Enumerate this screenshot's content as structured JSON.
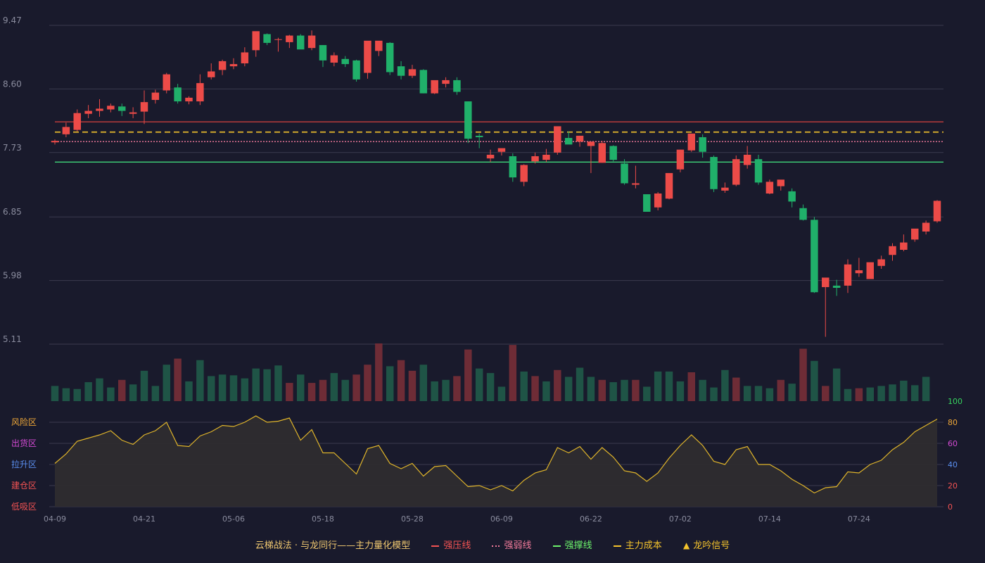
{
  "chart_data": [
    {
      "type": "candlestick",
      "y_ticks": [
        "9.47",
        "8.60",
        "7.73",
        "6.85",
        "5.98",
        "5.11"
      ],
      "ylim": [
        5.11,
        9.47
      ],
      "x_tick_labels": [
        "04-09",
        "04-21",
        "05-06",
        "05-18",
        "05-28",
        "06-09",
        "06-22",
        "07-02",
        "07-14",
        "07-24"
      ],
      "x_tick_index": [
        0,
        8,
        16,
        24,
        32,
        40,
        48,
        56,
        64,
        72
      ],
      "ohlc": [
        [
          7.87,
          7.91,
          7.84,
          7.89
        ],
        [
          7.98,
          8.14,
          7.94,
          8.08
        ],
        [
          8.04,
          8.32,
          8.02,
          8.27
        ],
        [
          8.26,
          8.38,
          8.2,
          8.3
        ],
        [
          8.3,
          8.46,
          8.22,
          8.33
        ],
        [
          8.32,
          8.4,
          8.28,
          8.37
        ],
        [
          8.36,
          8.4,
          8.23,
          8.3
        ],
        [
          8.26,
          8.35,
          8.2,
          8.28
        ],
        [
          8.29,
          8.58,
          8.12,
          8.42
        ],
        [
          8.45,
          8.59,
          8.4,
          8.55
        ],
        [
          8.58,
          8.82,
          8.54,
          8.8
        ],
        [
          8.62,
          8.67,
          8.4,
          8.43
        ],
        [
          8.43,
          8.5,
          8.39,
          8.48
        ],
        [
          8.43,
          8.8,
          8.38,
          8.68
        ],
        [
          8.76,
          8.95,
          8.73,
          8.84
        ],
        [
          8.86,
          9.0,
          8.79,
          8.98
        ],
        [
          8.91,
          9.02,
          8.87,
          8.94
        ],
        [
          8.95,
          9.17,
          8.91,
          9.1
        ],
        [
          9.13,
          9.3,
          9.04,
          9.39
        ],
        [
          9.35,
          9.36,
          9.2,
          9.23
        ],
        [
          9.28,
          9.3,
          9.11,
          9.28
        ],
        [
          9.24,
          9.34,
          9.16,
          9.33
        ],
        [
          9.33,
          9.35,
          9.15,
          9.14
        ],
        [
          9.16,
          9.4,
          9.13,
          9.33
        ],
        [
          9.2,
          9.2,
          8.9,
          8.99
        ],
        [
          8.96,
          9.1,
          8.91,
          9.06
        ],
        [
          9.01,
          9.05,
          8.9,
          8.94
        ],
        [
          8.99,
          9.0,
          8.7,
          8.73
        ],
        [
          8.82,
          9.23,
          8.74,
          9.26
        ],
        [
          9.12,
          9.24,
          9.05,
          9.26
        ],
        [
          9.23,
          9.24,
          8.79,
          8.83
        ],
        [
          8.91,
          8.98,
          8.73,
          8.78
        ],
        [
          8.78,
          8.93,
          8.75,
          8.87
        ],
        [
          8.86,
          8.87,
          8.54,
          8.54
        ],
        [
          8.54,
          8.68,
          8.53,
          8.72
        ],
        [
          8.67,
          8.76,
          8.62,
          8.72
        ],
        [
          8.72,
          8.76,
          8.52,
          8.56
        ],
        [
          8.43,
          8.43,
          7.86,
          7.92
        ],
        [
          7.96,
          7.99,
          7.79,
          7.94
        ],
        [
          7.65,
          7.77,
          7.6,
          7.7
        ],
        [
          7.74,
          7.77,
          7.69,
          7.79
        ],
        [
          7.68,
          7.72,
          7.33,
          7.39
        ],
        [
          7.33,
          7.57,
          7.27,
          7.56
        ],
        [
          7.61,
          7.73,
          7.58,
          7.68
        ],
        [
          7.63,
          7.78,
          7.6,
          7.7
        ],
        [
          7.73,
          8.04,
          7.7,
          8.09
        ],
        [
          7.93,
          8.02,
          7.85,
          7.84
        ],
        [
          7.88,
          7.96,
          7.81,
          7.96
        ],
        [
          7.82,
          7.87,
          7.45,
          7.88
        ],
        [
          7.59,
          7.89,
          7.59,
          7.86
        ],
        [
          7.82,
          7.83,
          7.61,
          7.63
        ],
        [
          7.58,
          7.64,
          7.29,
          7.31
        ],
        [
          7.29,
          7.55,
          7.24,
          7.31
        ],
        [
          7.16,
          7.16,
          6.95,
          6.92
        ],
        [
          6.98,
          7.19,
          6.94,
          7.17
        ],
        [
          7.1,
          7.43,
          7.09,
          7.45
        ],
        [
          7.5,
          7.77,
          7.46,
          7.77
        ],
        [
          7.76,
          7.9,
          7.74,
          7.99
        ],
        [
          7.94,
          7.98,
          7.66,
          7.74
        ],
        [
          7.67,
          7.69,
          7.19,
          7.23
        ],
        [
          7.21,
          7.32,
          7.18,
          7.25
        ],
        [
          7.29,
          7.69,
          7.27,
          7.64
        ],
        [
          7.56,
          7.82,
          7.51,
          7.7
        ],
        [
          7.64,
          7.7,
          7.29,
          7.32
        ],
        [
          7.17,
          7.36,
          7.16,
          7.33
        ],
        [
          7.27,
          7.34,
          7.21,
          7.36
        ],
        [
          7.2,
          7.24,
          6.98,
          7.06
        ],
        [
          6.97,
          7.02,
          6.8,
          6.81
        ],
        [
          6.81,
          6.85,
          5.81,
          5.82
        ],
        [
          5.89,
          6.0,
          5.21,
          6.02
        ],
        [
          5.91,
          5.99,
          5.77,
          5.88
        ],
        [
          5.91,
          6.27,
          5.81,
          6.2
        ],
        [
          6.08,
          6.29,
          6.03,
          6.12
        ],
        [
          6.0,
          6.22,
          6.0,
          6.23
        ],
        [
          6.18,
          6.32,
          6.14,
          6.27
        ],
        [
          6.33,
          6.49,
          6.25,
          6.45
        ],
        [
          6.4,
          6.61,
          6.38,
          6.5
        ],
        [
          6.54,
          6.62,
          6.51,
          6.69
        ],
        [
          6.65,
          6.8,
          6.61,
          6.77
        ],
        [
          6.79,
          7.08,
          6.77,
          7.07
        ]
      ],
      "reference_lines": [
        {
          "name": "强压线",
          "value": 8.15,
          "color": "#d9413e"
        },
        {
          "name": "强弱线",
          "value": 7.88,
          "color": "#f27b9b"
        },
        {
          "name": "强撑线",
          "value": 7.6,
          "color": "#3fd67a"
        },
        {
          "name": "主力成本",
          "value": 8.01,
          "color": "#f5c42c"
        }
      ],
      "volume": [
        20,
        17,
        16,
        25,
        30,
        18,
        28,
        22,
        40,
        20,
        48,
        56,
        26,
        54,
        33,
        35,
        34,
        30,
        43,
        42,
        47,
        24,
        35,
        24,
        28,
        37,
        28,
        35,
        48,
        76,
        46,
        54,
        40,
        48,
        26,
        28,
        33,
        68,
        43,
        37,
        19,
        74,
        39,
        33,
        26,
        41,
        32,
        44,
        32,
        28,
        25,
        28,
        28,
        19,
        39,
        39,
        26,
        38,
        28,
        18,
        41,
        31,
        20,
        20,
        17,
        28,
        23,
        69,
        53,
        20,
        43,
        16,
        17,
        18,
        20,
        22,
        27,
        21,
        32
      ],
      "volume_up": [
        false,
        false,
        false,
        false,
        false,
        false,
        true,
        false,
        false,
        false,
        false,
        true,
        false,
        false,
        false,
        false,
        false,
        false,
        false,
        false,
        false,
        true,
        false,
        true,
        true,
        false,
        false,
        true,
        true,
        true,
        false,
        true,
        true,
        false,
        false,
        false,
        true,
        true,
        false,
        false,
        false,
        true,
        false,
        true,
        false,
        true,
        false,
        false,
        false,
        true,
        false,
        false,
        true,
        false,
        false,
        false,
        false,
        true,
        false,
        false,
        false,
        true,
        false,
        false,
        false,
        true,
        false,
        true,
        false,
        true,
        false,
        false,
        true,
        false,
        false,
        false,
        false,
        false,
        false
      ]
    },
    {
      "type": "area",
      "name": "indicator",
      "y_ticks": [
        "100",
        "80",
        "60",
        "40",
        "20",
        "0"
      ],
      "ylim": [
        0,
        100
      ],
      "zones": [
        "风险区",
        "出货区",
        "拉升区",
        "建仓区",
        "低吸区"
      ],
      "values": [
        41,
        50,
        62,
        65,
        68,
        72,
        63,
        59,
        68,
        72,
        80,
        58,
        57,
        67,
        71,
        77,
        76,
        80,
        86,
        80,
        81,
        84,
        63,
        73,
        51,
        51,
        41,
        31,
        55,
        58,
        41,
        36,
        41,
        29,
        38,
        39,
        29,
        19,
        20,
        16,
        20,
        15,
        25,
        32,
        35,
        56,
        51,
        57,
        45,
        56,
        47,
        34,
        32,
        24,
        32,
        46,
        58,
        68,
        58,
        43,
        40,
        54,
        57,
        40,
        40,
        34,
        26,
        20,
        13,
        18,
        19,
        33,
        32,
        40,
        44,
        54,
        61,
        71,
        77,
        83
      ]
    }
  ],
  "legend": {
    "title": "云梯战法 · 与龙同行——主力量化模型",
    "items": [
      {
        "label": "强压线",
        "color": "#f35353",
        "style": "solid"
      },
      {
        "label": "强弱线",
        "color": "#f27b9b",
        "style": "dotted"
      },
      {
        "label": "强撑线",
        "color": "#6cf26c",
        "style": "solid"
      },
      {
        "label": "主力成本",
        "color": "#f5c42c",
        "style": "dashed"
      },
      {
        "label": "龙吟信号",
        "color": "#f5c42c",
        "style": "triangle"
      }
    ]
  },
  "colors": {
    "up": "#ec4b48",
    "down": "#20b06a",
    "vol_up": "#6e2c36",
    "vol_down": "#1f5446",
    "grid": "#3a3b4e",
    "axis_text": "#8a8c9e",
    "indicator_line": "#e0b52a",
    "indicator_fill": "#2e2c2f",
    "tick_100": "#37d65f",
    "tick_80": "#f0a838",
    "tick_60": "#d34ad3",
    "tick_40": "#5a8ff0",
    "tick_20": "#f35353",
    "tick_0": "#f35353",
    "zone_colors": [
      "#f0a838",
      "#d34ad3",
      "#5a8ff0",
      "#f35353",
      "#f35353"
    ]
  }
}
